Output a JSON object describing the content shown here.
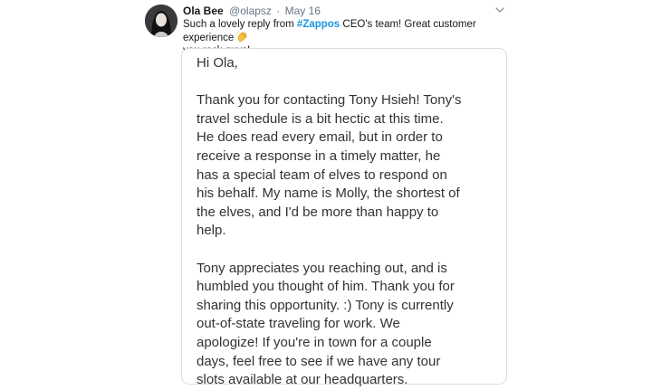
{
  "tweet": {
    "author_name": "Ola Bee",
    "author_handle": "@olapsz",
    "separator": "·",
    "date": "May 16",
    "text_before_hashtag": "Such a lovely reply from ",
    "hashtag": "#Zappos",
    "text_after_hashtag": " CEO's team! Great customer experience ",
    "text_line2": "you rock guys!",
    "emoji_icon": "clapping-hands-icon",
    "menu_icon": "chevron-down-icon",
    "colors": {
      "hashtag": "#1b95e0",
      "meta": "#657786",
      "text": "#14171a",
      "card_border": "#d9dee2",
      "letter_text": "#333333"
    }
  },
  "attachment": {
    "greeting": "Hi Ola,",
    "paragraph1": "Thank you for contacting Tony Hsieh! Tony's\ntravel schedule is a bit hectic at this time.\nHe does read every email, but in order to\nreceive a response in a timely matter, he\nhas a special team of elves to respond on\nhis behalf. My name is Molly, the shortest of\nthe elves, and I'd be more than happy to\nhelp.",
    "paragraph2": "Tony appreciates you reaching out, and is\nhumbled you thought of him. Thank you for\nsharing this opportunity. :) Tony is currently\nout-of-state traveling for work. We\napologize! If you're in town for a couple\ndays, feel free to see if we have any tour\nslots available at our headquarters."
  }
}
